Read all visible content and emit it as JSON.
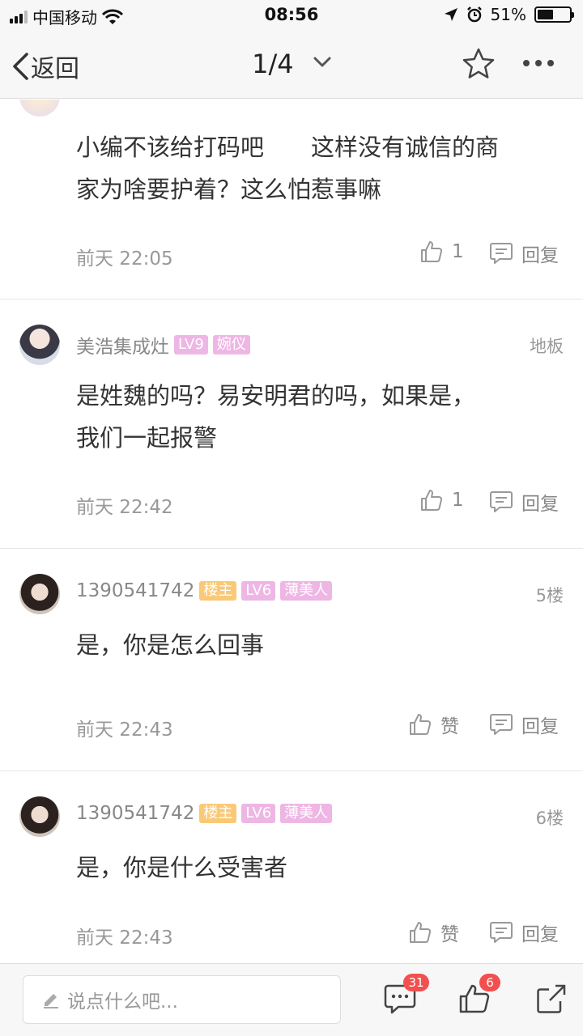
{
  "status_bar": {
    "carrier": "中国移动",
    "time": "08:56",
    "battery_pct": "51%",
    "battery_level": 0.51
  },
  "nav": {
    "back_label": "返回",
    "page_indicator": "1/4"
  },
  "comments": [
    {
      "username": "",
      "badges": [],
      "floor": "",
      "text_lines": [
        "小编不该给打码吧　　这样没有诚信的商",
        "家为啥要护着？这么怕惹事嘛"
      ],
      "time": "前天 22:05",
      "like_label": "1",
      "reply_label": "回复"
    },
    {
      "username": "美浩集成灶",
      "badges": [
        "LV9",
        "婉仪"
      ],
      "floor": "地板",
      "text_lines": [
        "是姓魏的吗？易安明君的吗，如果是，",
        "我们一起报警"
      ],
      "time": "前天 22:42",
      "like_label": "1",
      "reply_label": "回复"
    },
    {
      "username": "1390541742",
      "badges": [
        "楼主",
        "LV6",
        "薄美人"
      ],
      "floor": "5楼",
      "text_lines": [
        "是，你是怎么回事"
      ],
      "time": "前天 22:43",
      "like_label": "赞",
      "reply_label": "回复"
    },
    {
      "username": "1390541742",
      "badges": [
        "楼主",
        "LV6",
        "薄美人"
      ],
      "floor": "6楼",
      "text_lines": [
        "是，你是什么受害者"
      ],
      "time": "前天 22:43",
      "like_label": "赞",
      "reply_label": "回复"
    }
  ],
  "bottom_bar": {
    "input_placeholder": "说点什么吧...",
    "comment_count": "31",
    "like_count": "6"
  },
  "colors": {
    "badge_owner": "#f9c978",
    "badge_pink": "#eeb6e4",
    "count_red": "#f0504f",
    "text_main": "#333333",
    "text_muted": "#999999"
  },
  "icons": [
    "signal-icon",
    "wifi-icon",
    "location-icon",
    "alarm-icon",
    "battery-icon",
    "back-chevron-icon",
    "chevron-down-icon",
    "star-icon",
    "more-icon",
    "thumbs-up-icon",
    "reply-bubble-icon",
    "pencil-icon",
    "comment-icon",
    "share-icon"
  ]
}
